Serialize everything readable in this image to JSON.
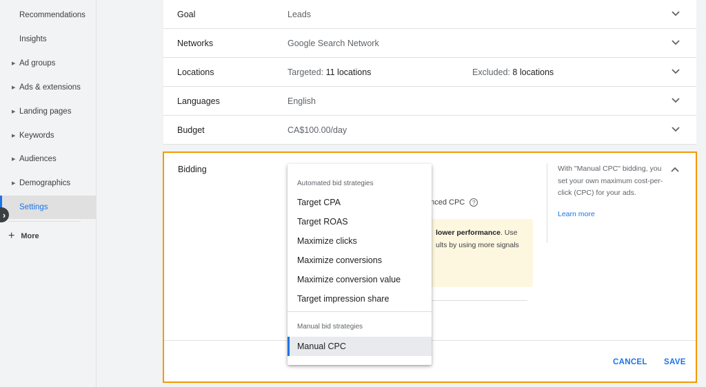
{
  "sidebar": {
    "items": [
      {
        "label": "Recommendations",
        "expandable": false
      },
      {
        "label": "Insights",
        "expandable": false
      },
      {
        "label": "Ad groups",
        "expandable": true
      },
      {
        "label": "Ads & extensions",
        "expandable": true
      },
      {
        "label": "Landing pages",
        "expandable": true
      },
      {
        "label": "Keywords",
        "expandable": true
      },
      {
        "label": "Audiences",
        "expandable": true
      },
      {
        "label": "Demographics",
        "expandable": true
      },
      {
        "label": "Settings",
        "expandable": false,
        "active": true
      }
    ],
    "more_label": "More",
    "collapse_icon": "chevron-right-icon"
  },
  "settings": {
    "goal": {
      "label": "Goal",
      "value": "Leads"
    },
    "networks": {
      "label": "Networks",
      "value": "Google Search Network"
    },
    "locations": {
      "label": "Locations",
      "targeted_prefix": "Targeted:",
      "targeted_value": "11 locations",
      "excluded_prefix": "Excluded:",
      "excluded_value": "8 locations"
    },
    "languages": {
      "label": "Languages",
      "value": "English"
    },
    "budget": {
      "label": "Budget",
      "value": "CA$100.00/day"
    }
  },
  "bidding": {
    "label": "Bidding",
    "partial_text": "anced CPC",
    "warning_bold": "lower performance",
    "warning_rest_1": ". Use",
    "warning_line_2": "ults by using more signals",
    "help_text": "With \"Manual CPC\" bidding, you set your own maximum cost-per-click (CPC) for your ads.",
    "learn_more": "Learn more",
    "cancel": "CANCEL",
    "save": "SAVE"
  },
  "dropdown": {
    "automated_header": "Automated bid strategies",
    "automated_items": [
      "Target CPA",
      "Target ROAS",
      "Maximize clicks",
      "Maximize conversions",
      "Maximize conversion value",
      "Target impression share"
    ],
    "manual_header": "Manual bid strategies",
    "manual_items": [
      "Manual CPC"
    ],
    "selected": "Manual CPC"
  },
  "colors": {
    "accent": "#1a73e8",
    "highlight_border": "#f29900",
    "warning_bg": "#fef7e0"
  }
}
